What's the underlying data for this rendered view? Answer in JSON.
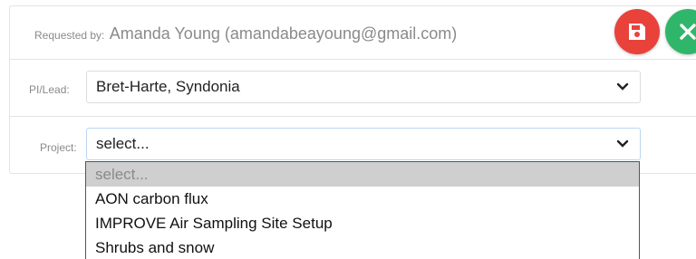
{
  "requested_by": {
    "label": "Requested by:",
    "value": "Amanda Young (amandabeayoung@gmail.com)"
  },
  "pi_lead": {
    "label": "PI/Lead:",
    "selected": "Bret-Harte, Syndonia"
  },
  "project": {
    "label": "Project:",
    "selected": "select...",
    "options": [
      "select...",
      "AON carbon flux",
      "IMPROVE Air Sampling Site Setup",
      "Shrubs and snow"
    ]
  },
  "actions": {
    "save_icon": "floppy-disk-icon",
    "cancel_icon": "close-icon"
  },
  "colors": {
    "save": "#e8423b",
    "cancel": "#2fb66a"
  }
}
